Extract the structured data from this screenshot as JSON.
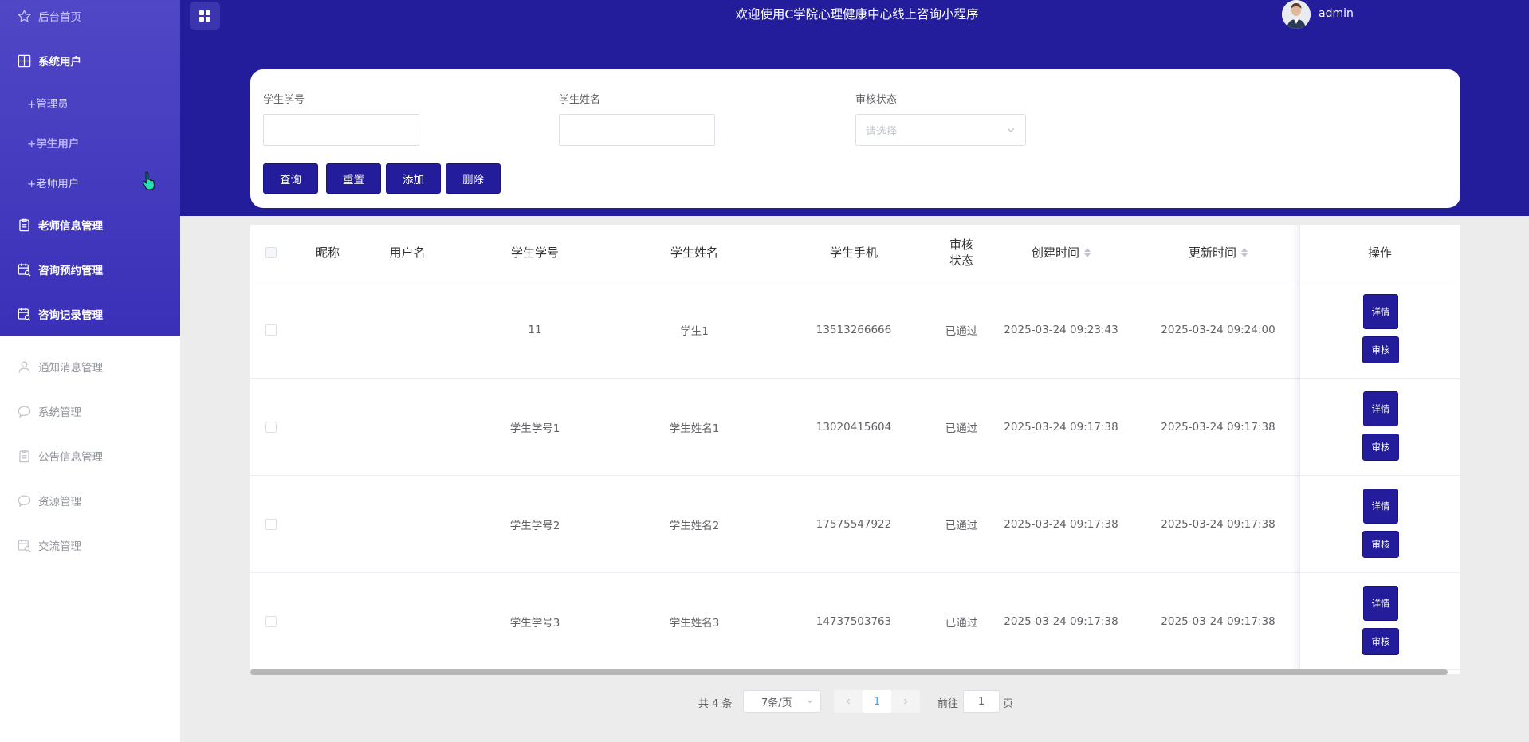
{
  "header": {
    "title": "欢迎使用C学院心理健康中心线上咨询小程序",
    "username": "admin"
  },
  "sidebar": {
    "items": [
      {
        "label": "后台首页",
        "icon": "star-icon"
      },
      {
        "label": "系统用户",
        "icon": "grid-icon"
      },
      {
        "label": "老师信息管理",
        "icon": "clipboard-icon"
      },
      {
        "label": "咨询预约管理",
        "icon": "calendar-search-icon"
      },
      {
        "label": "咨询记录管理",
        "icon": "calendar-search-icon"
      },
      {
        "label": "通知消息管理",
        "icon": "user-icon"
      },
      {
        "label": "系统管理",
        "icon": "chat-bubble-icon"
      },
      {
        "label": "公告信息管理",
        "icon": "clipboard-icon"
      },
      {
        "label": "资源管理",
        "icon": "chat-bubble-icon"
      },
      {
        "label": "交流管理",
        "icon": "calendar-search-icon"
      }
    ],
    "sub_items": [
      {
        "label": "+管理员"
      },
      {
        "label": "+学生用户"
      },
      {
        "label": "+老师用户"
      }
    ]
  },
  "search": {
    "student_no_label": "学生学号",
    "student_no_value": "",
    "student_name_label": "学生姓名",
    "student_name_value": "",
    "status_label": "审核状态",
    "status_placeholder": "请选择",
    "buttons": {
      "query": "查询",
      "reset": "重置",
      "add": "添加",
      "delete": "删除"
    }
  },
  "table": {
    "columns": [
      "昵称",
      "用户名",
      "学生学号",
      "学生姓名",
      "学生手机",
      "审核状态",
      "创建时间",
      "更新时间",
      "操作"
    ],
    "rows": [
      {
        "nickname": "",
        "username": "",
        "student_no": "11",
        "student_name": "学生1",
        "phone": "13513266666",
        "status": "已通过",
        "created": "2025-03-24 09:23:43",
        "updated": "2025-03-24 09:24:00"
      },
      {
        "nickname": "",
        "username": "",
        "student_no": "学生学号1",
        "student_name": "学生姓名1",
        "phone": "13020415604",
        "status": "已通过",
        "created": "2025-03-24 09:17:38",
        "updated": "2025-03-24 09:17:38"
      },
      {
        "nickname": "",
        "username": "",
        "student_no": "学生学号2",
        "student_name": "学生姓名2",
        "phone": "17575547922",
        "status": "已通过",
        "created": "2025-03-24 09:17:38",
        "updated": "2025-03-24 09:17:38"
      },
      {
        "nickname": "",
        "username": "",
        "student_no": "学生学号3",
        "student_name": "学生姓名3",
        "phone": "14737503763",
        "status": "已通过",
        "created": "2025-03-24 09:17:38",
        "updated": "2025-03-24 09:17:38"
      }
    ],
    "row_actions": {
      "detail": "详情",
      "audit": "审核"
    }
  },
  "pagination": {
    "total": "共 4 条",
    "page_size": "7条/页",
    "current_page": "1",
    "goto_prefix": "前往",
    "goto_value": "1",
    "goto_suffix": "页"
  },
  "colors": {
    "header_bg": "#231c9b",
    "sidebar_gradient_top": "#5047c6",
    "button_bg": "#231c9b",
    "page_bg": "#ececec",
    "link_active": "#409eff"
  }
}
